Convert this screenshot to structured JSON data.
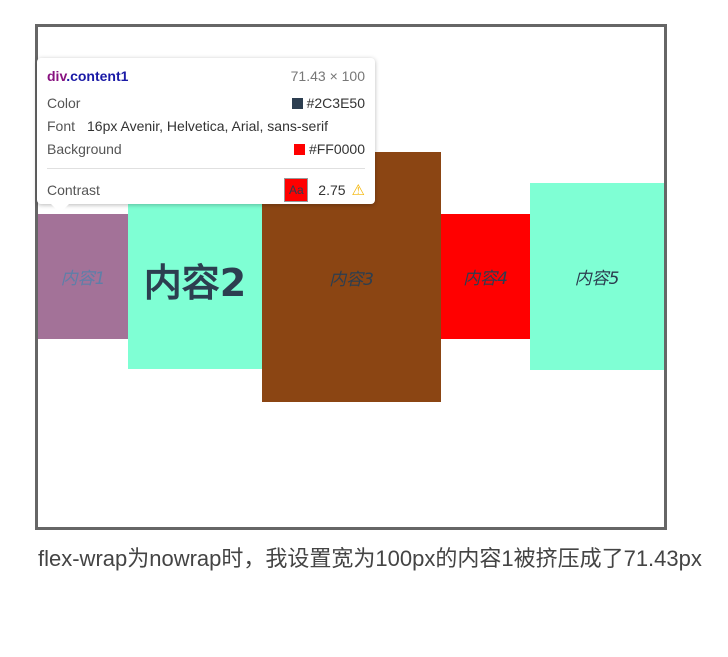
{
  "colors": {
    "content1_bg": "#A37298",
    "content1_text": "#5E7FA8",
    "content2_bg": "#7FFFD4",
    "content3_bg": "#8B4513",
    "content4_bg": "#FF0000",
    "content5_bg": "#7FFFD4",
    "text_color": "#2C3E50",
    "frame_border": "#666666"
  },
  "boxes": {
    "c1": "内容1",
    "c2": "内容2",
    "c3": "内容3",
    "c4": "内容4",
    "c5": "内容5"
  },
  "tooltip": {
    "tag": "div",
    "class_name": ".content1",
    "dims": "71.43 × 100",
    "color_label": "Color",
    "color_value": "#2C3E50",
    "font_label": "Font",
    "font_value": "16px Avenir, Helvetica, Arial, sans-serif",
    "bg_label": "Background",
    "bg_value": "#FF0000",
    "contrast_label": "Contrast",
    "contrast_sample": "Aa",
    "contrast_value": "2.75",
    "warning_icon": "warning-icon"
  },
  "caption": "flex-wrap为nowrap时，我设置宽为100px的内容1被挤压成了71.43px"
}
